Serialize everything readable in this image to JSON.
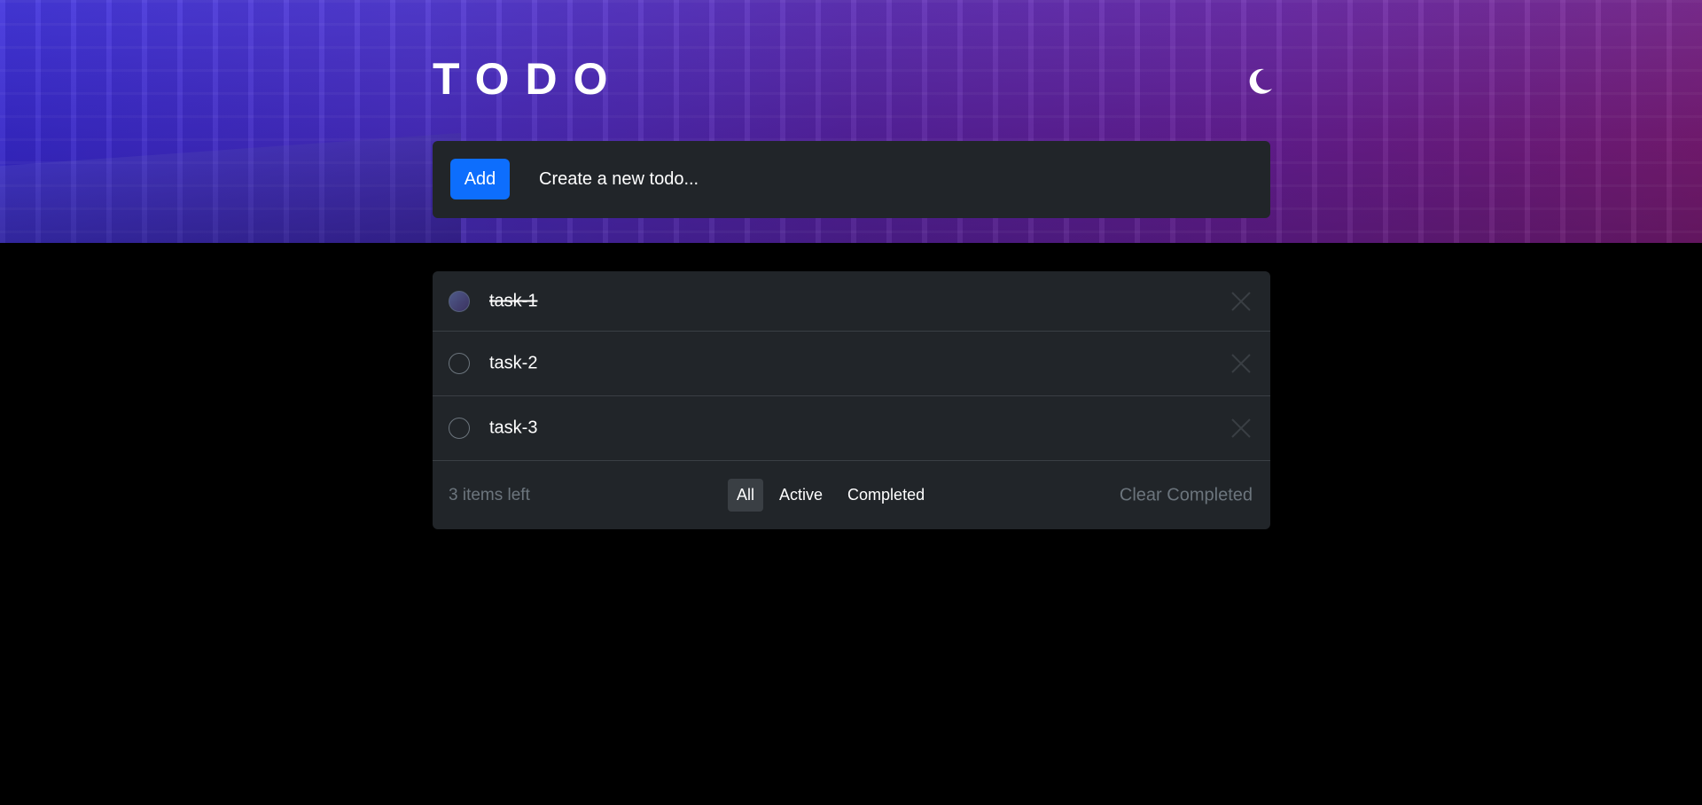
{
  "header": {
    "title": "TODO",
    "theme_toggle_icon": "moon-icon"
  },
  "add_bar": {
    "add_label": "Add",
    "placeholder": "Create a new todo..."
  },
  "todos": [
    {
      "text": "task-1",
      "completed": true
    },
    {
      "text": "task-2",
      "completed": false
    },
    {
      "text": "task-3",
      "completed": false
    }
  ],
  "footer": {
    "items_left": "3 items left",
    "filters": [
      {
        "label": "All",
        "active": true
      },
      {
        "label": "Active",
        "active": false
      },
      {
        "label": "Completed",
        "active": false
      }
    ],
    "clear_label": "Clear Completed"
  },
  "colors": {
    "accent": "#0d6efd",
    "panel": "#212529",
    "background": "#000000",
    "muted_text": "#6c757d"
  }
}
